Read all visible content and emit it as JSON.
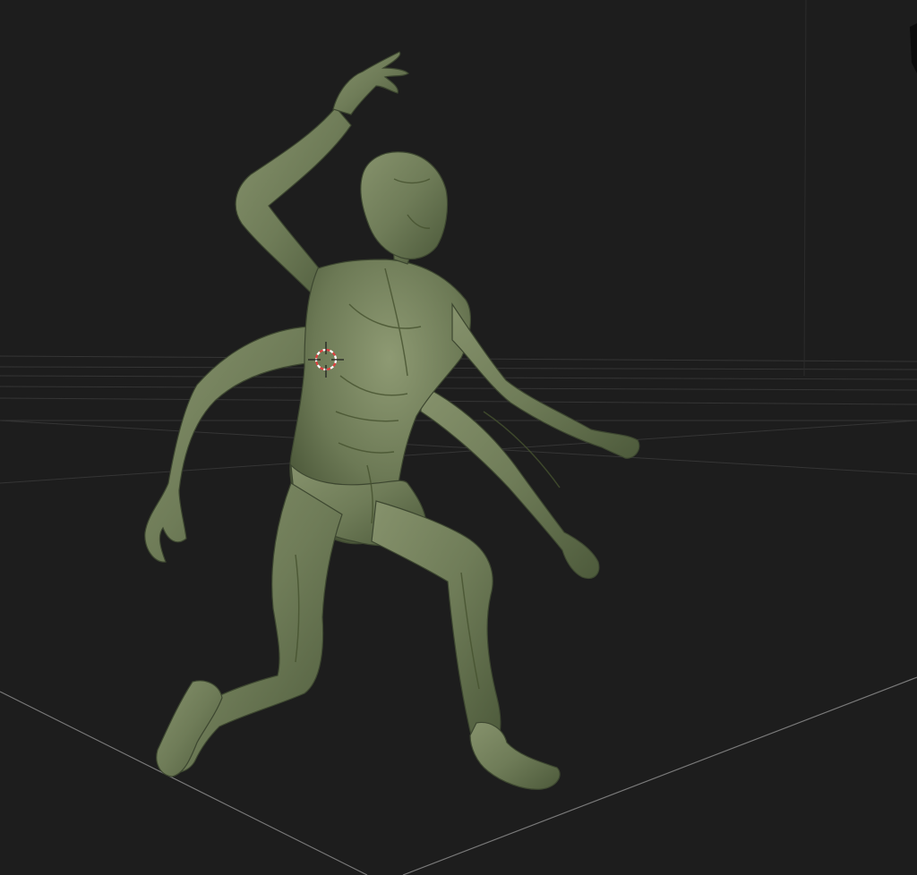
{
  "viewport": {
    "background": "#1d1d1d",
    "grid_color": "#3a3a3a",
    "floor_line_color": "#8a8a8a",
    "model_color": "#6f7c58",
    "model_shadow": "#3f4930",
    "model_highlight": "#8c9871",
    "cursor_color_a": "#e04040",
    "cursor_color_b": "#ffffff",
    "icons": [
      "3d-cursor-icon",
      "corner-gizmo-icon"
    ]
  }
}
